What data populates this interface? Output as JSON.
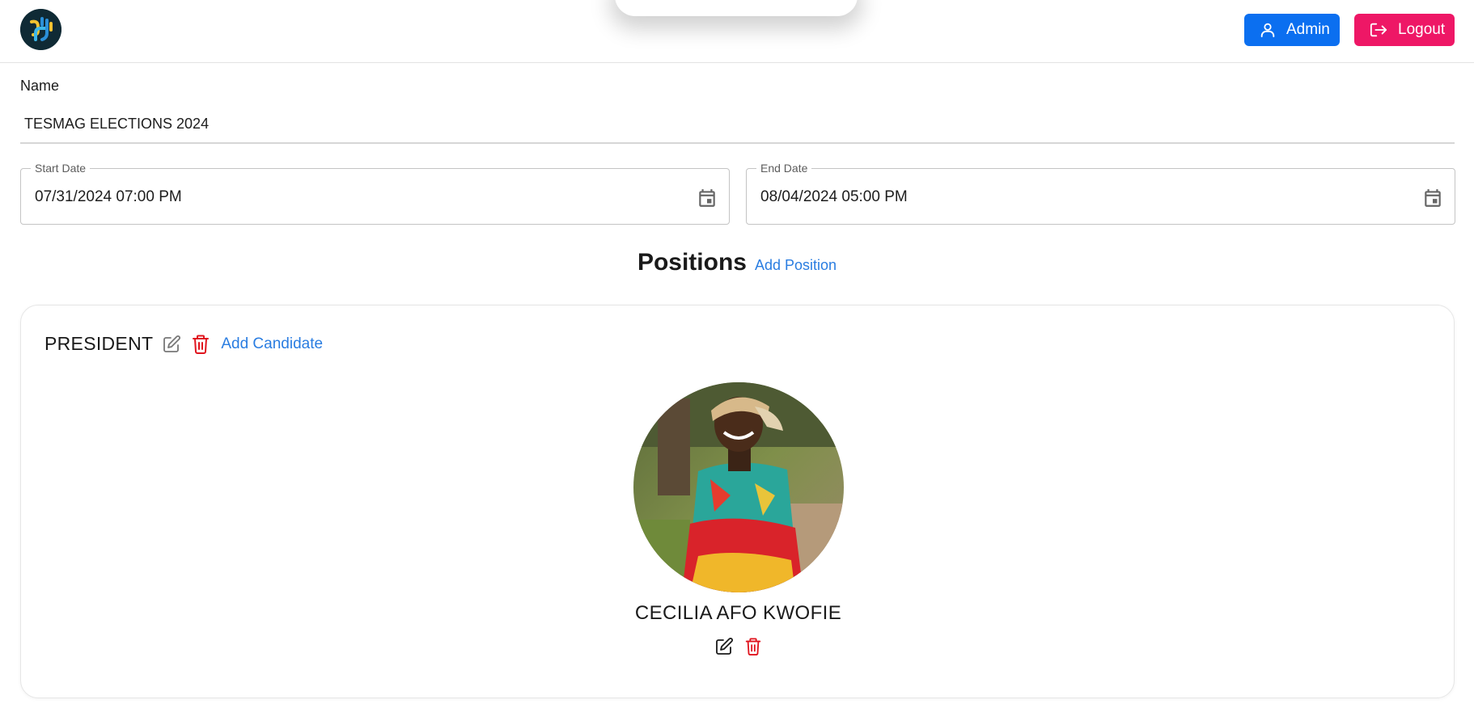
{
  "header": {
    "logo_alt": "SYP logo",
    "admin_label": "Admin",
    "logout_label": "Logout",
    "admin_color": "#0b6ff0",
    "logout_color": "#ee1766"
  },
  "form": {
    "name_label": "Name",
    "name_value": "TESMAG ELECTIONS 2024",
    "start_date_label": "Start Date",
    "start_date_value": "07/31/2024 07:00 PM",
    "end_date_label": "End Date",
    "end_date_value": "08/04/2024 05:00 PM"
  },
  "positions": {
    "title": "Positions",
    "add_label": "Add Position",
    "items": [
      {
        "name": "PRESIDENT",
        "add_candidate_label": "Add Candidate",
        "candidates": [
          {
            "name": "CECILIA AFO KWOFIE"
          }
        ]
      }
    ]
  },
  "icons": {
    "user": "user-icon",
    "logout": "logout-icon",
    "calendar": "calendar-icon",
    "edit": "edit-icon",
    "delete": "trash-icon"
  },
  "colors": {
    "link": "#2a7de1",
    "danger": "#e0141e"
  }
}
